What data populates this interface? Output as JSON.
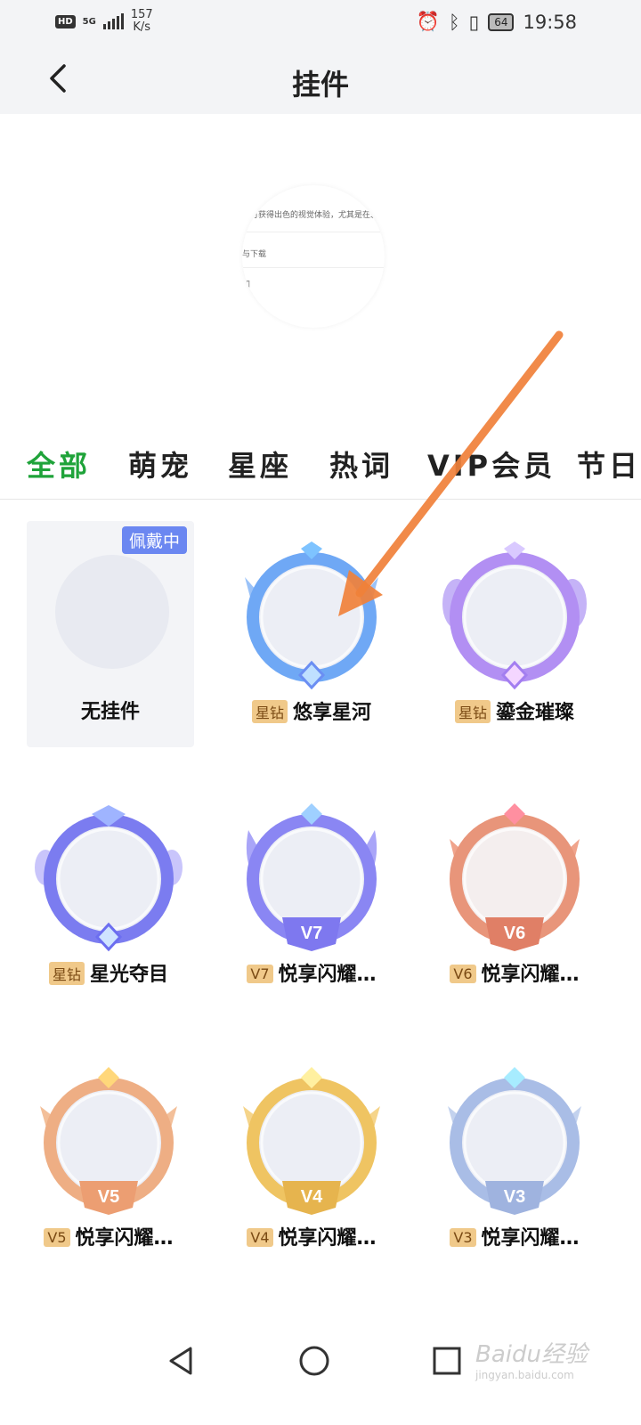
{
  "status_bar": {
    "hd": "HD",
    "network": "5G",
    "speed_value": "157",
    "speed_unit": "K/s",
    "battery": "64",
    "time": "19:58"
  },
  "header": {
    "title": "挂件",
    "back_icon": "chevron-left-icon"
  },
  "preview": {
    "lines": [
      "式可获得出色的视觉体验，尤其是在弱",
      "与下载",
      "知"
    ]
  },
  "tabs": [
    {
      "label": "全部",
      "active": true
    },
    {
      "label": "萌宠",
      "active": false
    },
    {
      "label": "星座",
      "active": false
    },
    {
      "label": "热词",
      "active": false
    },
    {
      "label": "VIP会员",
      "active": false
    },
    {
      "label": "节日",
      "active": false
    }
  ],
  "items": [
    {
      "name": "无挂件",
      "badge": "佩戴中",
      "tag": ""
    },
    {
      "name": "悠享星河",
      "tag": "星钻",
      "color": "#6fa8f5"
    },
    {
      "name": "鎏金璀璨",
      "tag": "星钻",
      "color": "#b28ff3"
    },
    {
      "name": "星光夺目",
      "tag": "星钻",
      "color": "#7b7cf0"
    },
    {
      "name": "悦享闪耀…",
      "tag": "V7",
      "color": "#8a86f3",
      "level": "V7"
    },
    {
      "name": "悦享闪耀…",
      "tag": "V6",
      "color": "#e8957a",
      "level": "V6"
    },
    {
      "name": "悦享闪耀…",
      "tag": "V5",
      "color": "#eeae84",
      "level": "V5"
    },
    {
      "name": "悦享闪耀…",
      "tag": "V4",
      "color": "#efc462",
      "level": "V4"
    },
    {
      "name": "悦享闪耀…",
      "tag": "V3",
      "color": "#a9bde6",
      "level": "V3"
    }
  ],
  "watermark": {
    "text": "Baidu经验",
    "sub": "jingyan.baidu.com"
  },
  "annotation_color": "#f0813a"
}
